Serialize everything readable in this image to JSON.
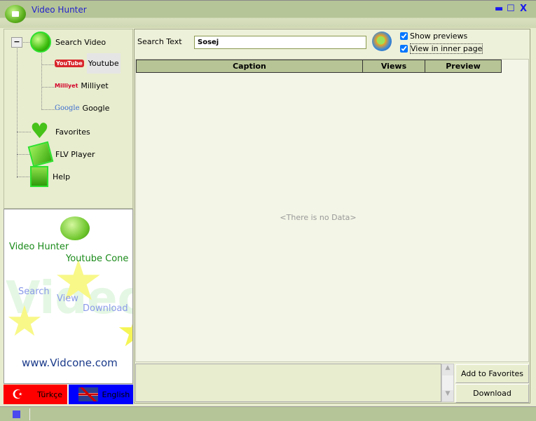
{
  "window": {
    "title": "Video Hunter",
    "minimize": "▬",
    "maximize": "☐",
    "close": "X"
  },
  "tree": {
    "search_video": "Search Video",
    "youtube": "Youtube",
    "youtube_logo": "YouTube",
    "milliyet": "Milliyet",
    "milliyet_logo": "Milliyet",
    "google": "Google",
    "google_logo": "Google",
    "favorites": "Favorites",
    "flv_player": "FLV Player",
    "help": "Help",
    "collapse": "−"
  },
  "banner": {
    "app": "Video Hunter",
    "product": "Youtube Cone",
    "watermark": "Video",
    "search": "Search",
    "view": "View",
    "download": "Download",
    "url": "www.Vidcone.com"
  },
  "languages": {
    "turkish": "Türkçe",
    "english": "English"
  },
  "search": {
    "label": "Search Text",
    "value": "Sosej",
    "show_previews": "Show previews",
    "view_inner": "View in inner page"
  },
  "table": {
    "columns": [
      "Caption",
      "Views",
      "Preview"
    ],
    "empty": "<There is no Data>"
  },
  "actions": {
    "add_favorites": "Add to Favorites",
    "download": "Download"
  }
}
